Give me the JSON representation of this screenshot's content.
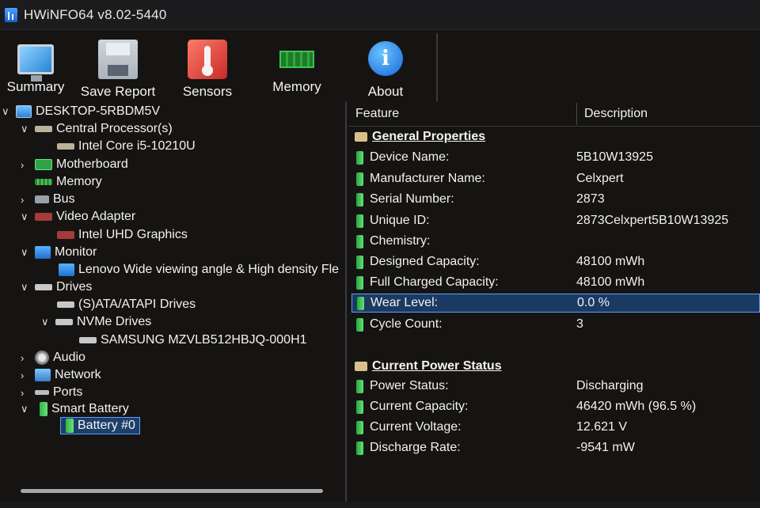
{
  "window": {
    "title": "HWiNFO64 v8.02-5440"
  },
  "toolbar": {
    "summary": "Summary",
    "save_report": "Save Report",
    "sensors": "Sensors",
    "memory": "Memory",
    "about": "About"
  },
  "tree": {
    "root": "DESKTOP-5RBDM5V",
    "cpu": "Central Processor(s)",
    "cpu_item": "Intel Core i5-10210U",
    "motherboard": "Motherboard",
    "memory": "Memory",
    "bus": "Bus",
    "video": "Video Adapter",
    "video_item": "Intel UHD Graphics",
    "monitor": "Monitor",
    "monitor_item": "Lenovo Wide viewing angle & High density Fle",
    "drives": "Drives",
    "sata": "(S)ATA/ATAPI Drives",
    "nvme": "NVMe Drives",
    "nvme_item": "SAMSUNG MZVLB512HBJQ-000H1",
    "audio": "Audio",
    "network": "Network",
    "ports": "Ports",
    "smart_battery": "Smart Battery",
    "battery": "Battery #0"
  },
  "detail": {
    "col_feature": "Feature",
    "col_description": "Description",
    "general_title": "General Properties",
    "general": [
      {
        "feature": "Device Name:",
        "value": "5B10W13925"
      },
      {
        "feature": "Manufacturer Name:",
        "value": "Celxpert"
      },
      {
        "feature": "Serial Number:",
        "value": "2873"
      },
      {
        "feature": "Unique ID:",
        "value": "2873Celxpert5B10W13925"
      },
      {
        "feature": "Chemistry:",
        "value": ""
      },
      {
        "feature": "Designed Capacity:",
        "value": "48100 mWh"
      },
      {
        "feature": "Full Charged Capacity:",
        "value": "48100 mWh"
      },
      {
        "feature": "Wear Level:",
        "value": "0.0 %"
      },
      {
        "feature": "Cycle Count:",
        "value": "3"
      }
    ],
    "power_title": "Current Power Status",
    "power": [
      {
        "feature": "Power Status:",
        "value": "Discharging"
      },
      {
        "feature": "Current Capacity:",
        "value": "46420 mWh (96.5 %)"
      },
      {
        "feature": "Current Voltage:",
        "value": "12.621 V"
      },
      {
        "feature": "Discharge Rate:",
        "value": "-9541 mW"
      }
    ]
  }
}
